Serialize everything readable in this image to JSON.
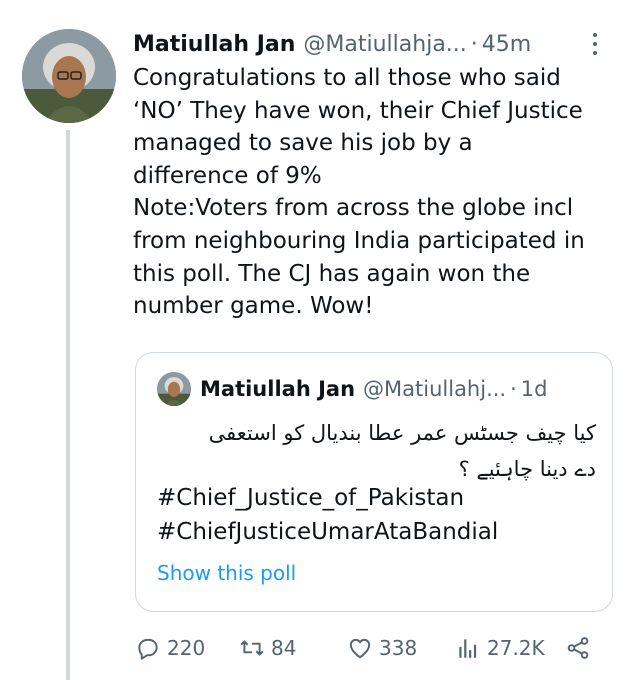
{
  "tweet": {
    "author_name": "Matiullah Jan",
    "handle": "@Matiullahja...",
    "separator": "·",
    "time": "45m",
    "text": "Congratulations to all those who said\n‘NO’ They have won, their Chief Justice\nmanaged to save his job by a\ndifference of 9%\nNote:Voters from across the globe incl\nfrom neighbouring India participated in\nthis poll. The CJ has again won the\nnumber game. Wow!"
  },
  "quoted_tweet": {
    "author_name": "Matiullah Jan",
    "handle": "@Matiullahj...",
    "separator": "·",
    "time": "1d",
    "urdu_line1": "کیا چیف جسٹس عمر عطا بندیال کو استعفی",
    "urdu_line2": "دے دینا چاہئیے ؟",
    "hashtag1": "#Chief_Justice_of_Pakistan",
    "hashtag2": "#ChiefJusticeUmarAtaBandial",
    "poll_link": "Show this poll"
  },
  "actions": {
    "replies": "220",
    "retweets": "84",
    "likes": "338",
    "views": "27.2K"
  },
  "icons": {
    "reply": "reply-icon",
    "retweet": "retweet-icon",
    "like": "heart-icon",
    "views": "views-chart-icon",
    "share": "share-icon",
    "more": "more-options-icon"
  },
  "colors": {
    "text": "#0f1419",
    "secondary": "#536471",
    "link": "#1d9bf0",
    "border": "#cfd9de"
  }
}
